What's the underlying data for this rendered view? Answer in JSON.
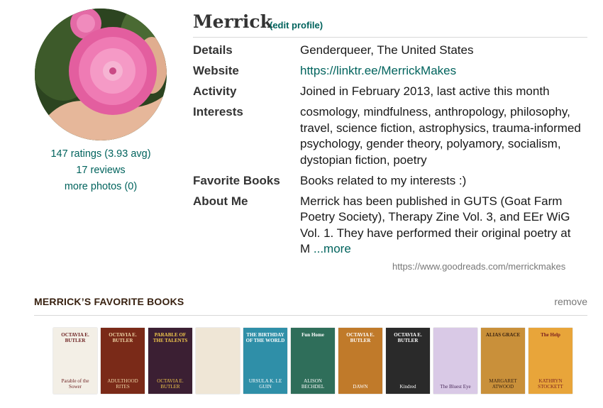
{
  "profile": {
    "name": "Merrick",
    "edit_label": "(edit profile)",
    "ratings": "147 ratings (3.93 avg)",
    "reviews": "17 reviews",
    "more_photos": "more photos (0)",
    "url": "https://www.goodreads.com/merrickmakes"
  },
  "info": {
    "details_label": "Details",
    "details_value": "Genderqueer, The United States",
    "website_label": "Website",
    "website_value": "https://linktr.ee/MerrickMakes",
    "activity_label": "Activity",
    "activity_value": "Joined in February 2013, last active this month",
    "interests_label": "Interests",
    "interests_value": "cosmology, mindfulness, anthropology, philosophy, travel, science fiction, astrophysics, trauma-informed psychology, gender theory, polyamory, socialism, dystopian fiction, poetry",
    "favorite_books_label": "Favorite Books",
    "favorite_books_value": "Books related to my interests :)",
    "about_label": "About Me",
    "about_value": "Merrick has been published in GUTS (Goat Farm Poetry Society), Therapy Zine Vol. 3, and EEr WiG Vol. 1. They have performed their original poetry at M ",
    "about_more": "...more"
  },
  "favorites": {
    "title": "MERRICK’S FAVORITE BOOKS",
    "remove_label": "remove",
    "books": [
      {
        "title": "OCTAVIA E. BUTLER",
        "subtitle": "Parable of the Sower",
        "bg": "#f3efe6",
        "fg": "#6b1f1f"
      },
      {
        "title": "OCTAVIA E. BUTLER",
        "subtitle": "ADULTHOOD RITES",
        "bg": "#7a2a18",
        "fg": "#f0d7a8"
      },
      {
        "title": "PARABLE OF THE TALENTS",
        "subtitle": "OCTAVIA E. BUTLER",
        "bg": "#3b1f33",
        "fg": "#f2c94c"
      },
      {
        "title": "",
        "subtitle": "",
        "bg": "#efe6d6",
        "fg": "#7a4a2a"
      },
      {
        "title": "THE BIRTHDAY OF THE WORLD",
        "subtitle": "URSULA K. LE GUIN",
        "bg": "#2f8fa8",
        "fg": "#ffffff"
      },
      {
        "title": "Fun Home",
        "subtitle": "ALISON BECHDEL",
        "bg": "#2f6e5a",
        "fg": "#ffffff"
      },
      {
        "title": "OCTAVIA E. BUTLER",
        "subtitle": "DAWN",
        "bg": "#c07a2a",
        "fg": "#ffffff"
      },
      {
        "title": "OCTAVIA E. BUTLER",
        "subtitle": "Kindred",
        "bg": "#2a2a2a",
        "fg": "#ffffff"
      },
      {
        "title": "",
        "subtitle": "The Bluest Eye",
        "bg": "#d9c9e6",
        "fg": "#4a2a5a"
      },
      {
        "title": "ALIAS GRACE",
        "subtitle": "MARGARET ATWOOD",
        "bg": "#c9903a",
        "fg": "#3a2210"
      },
      {
        "title": "The Help",
        "subtitle": "KATHRYN STOCKETT",
        "bg": "#e8a53a",
        "fg": "#7a1f1f"
      }
    ]
  },
  "colors": {
    "link": "#00635d",
    "heading": "#382110",
    "muted": "#777777"
  }
}
